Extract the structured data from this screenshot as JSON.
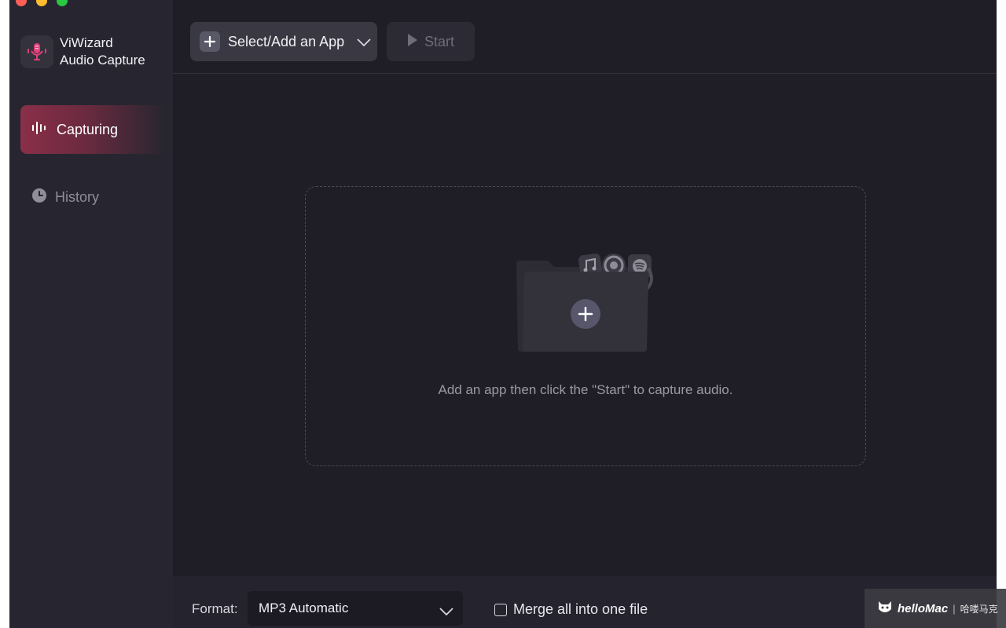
{
  "app": {
    "name_line1": "ViWizard",
    "name_line2": "Audio Capture",
    "logo_icon": "microphone-icon",
    "accent_color": "#e0407a"
  },
  "sidebar": {
    "items": [
      {
        "label": "Capturing",
        "icon": "audio-wave-icon",
        "active": true
      },
      {
        "label": "History",
        "icon": "clock-icon",
        "active": false
      }
    ]
  },
  "toolbar": {
    "select_label": "Select/Add an App",
    "start_label": "Start"
  },
  "dropzone": {
    "hint": "Add an app then click the \"Start\" to capture audio.",
    "app_icons": [
      "music-icon",
      "chrome-icon",
      "spotify-icon"
    ]
  },
  "bottom": {
    "format_label": "Format:",
    "format_value": "MP3 Automatic",
    "merge_label": "Merge all into one file",
    "merge_checked": false
  },
  "watermark": {
    "brand": "helloMac",
    "separator": "|",
    "chinese": "哈喽马克"
  }
}
